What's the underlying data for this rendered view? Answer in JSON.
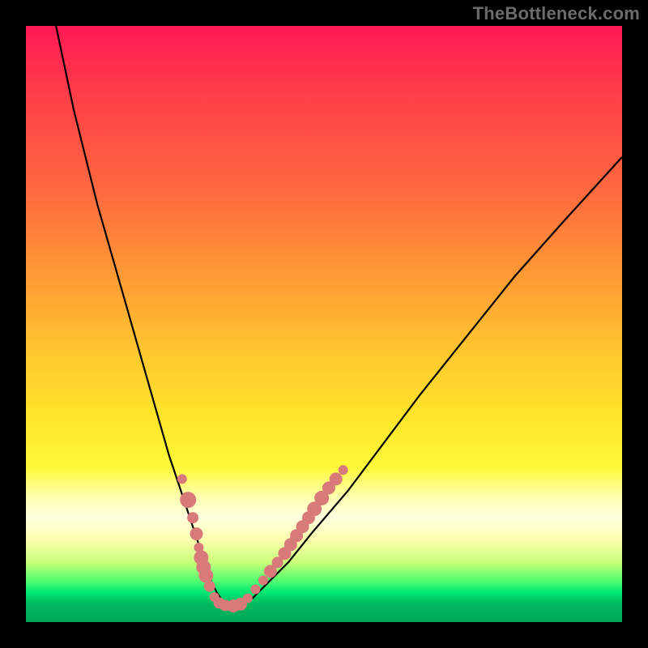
{
  "watermark": "TheBottleneck.com",
  "chart_data": {
    "type": "line",
    "title": "",
    "xlabel": "",
    "ylabel": "",
    "xlim": [
      0,
      100
    ],
    "ylim": [
      0,
      100
    ],
    "series": [
      {
        "name": "curve",
        "x": [
          4,
          8,
          12,
          16,
          20,
          24,
          26,
          28,
          30,
          31,
          32,
          33,
          34,
          36,
          38,
          40,
          44,
          48,
          54,
          60,
          66,
          74,
          82,
          90,
          100
        ],
        "y": [
          105,
          86,
          70,
          56,
          42,
          28,
          22,
          16,
          10,
          7,
          5,
          3.5,
          3,
          3,
          4,
          6,
          10,
          15,
          22,
          30,
          38,
          48,
          58,
          67,
          78
        ]
      }
    ],
    "markers": {
      "name": "salmon-dots",
      "color": "#d97a7a",
      "points": [
        {
          "x": 26.2,
          "y": 24.0,
          "r": 6
        },
        {
          "x": 27.2,
          "y": 20.5,
          "r": 10
        },
        {
          "x": 28.0,
          "y": 17.5,
          "r": 7
        },
        {
          "x": 28.6,
          "y": 14.8,
          "r": 8
        },
        {
          "x": 29.0,
          "y": 12.5,
          "r": 6
        },
        {
          "x": 29.4,
          "y": 10.8,
          "r": 9
        },
        {
          "x": 29.8,
          "y": 9.2,
          "r": 9
        },
        {
          "x": 30.2,
          "y": 7.8,
          "r": 9
        },
        {
          "x": 30.8,
          "y": 6.0,
          "r": 7
        },
        {
          "x": 31.6,
          "y": 4.2,
          "r": 6
        },
        {
          "x": 32.4,
          "y": 3.2,
          "r": 7
        },
        {
          "x": 33.4,
          "y": 2.8,
          "r": 7
        },
        {
          "x": 34.2,
          "y": 2.7,
          "r": 6
        },
        {
          "x": 34.8,
          "y": 2.7,
          "r": 8
        },
        {
          "x": 36.0,
          "y": 3.0,
          "r": 8
        },
        {
          "x": 37.2,
          "y": 4.0,
          "r": 6
        },
        {
          "x": 38.5,
          "y": 5.5,
          "r": 6
        },
        {
          "x": 39.8,
          "y": 7.0,
          "r": 6
        },
        {
          "x": 41.0,
          "y": 8.5,
          "r": 8
        },
        {
          "x": 42.2,
          "y": 10.0,
          "r": 7
        },
        {
          "x": 43.4,
          "y": 11.5,
          "r": 8
        },
        {
          "x": 44.4,
          "y": 13.0,
          "r": 8
        },
        {
          "x": 45.4,
          "y": 14.5,
          "r": 8
        },
        {
          "x": 46.4,
          "y": 16.0,
          "r": 8
        },
        {
          "x": 47.4,
          "y": 17.5,
          "r": 8
        },
        {
          "x": 48.4,
          "y": 19.0,
          "r": 9
        },
        {
          "x": 49.6,
          "y": 20.8,
          "r": 9
        },
        {
          "x": 50.8,
          "y": 22.5,
          "r": 8
        },
        {
          "x": 52.0,
          "y": 24.0,
          "r": 8
        },
        {
          "x": 53.2,
          "y": 25.5,
          "r": 6
        }
      ]
    },
    "background_gradient": {
      "stops": [
        {
          "pos": 0.0,
          "color": "#ff1a55"
        },
        {
          "pos": 0.42,
          "color": "#ff9a35"
        },
        {
          "pos": 0.74,
          "color": "#fff838"
        },
        {
          "pos": 0.83,
          "color": "#ffffe0"
        },
        {
          "pos": 0.95,
          "color": "#00e874"
        },
        {
          "pos": 1.0,
          "color": "#00a856"
        }
      ]
    }
  }
}
